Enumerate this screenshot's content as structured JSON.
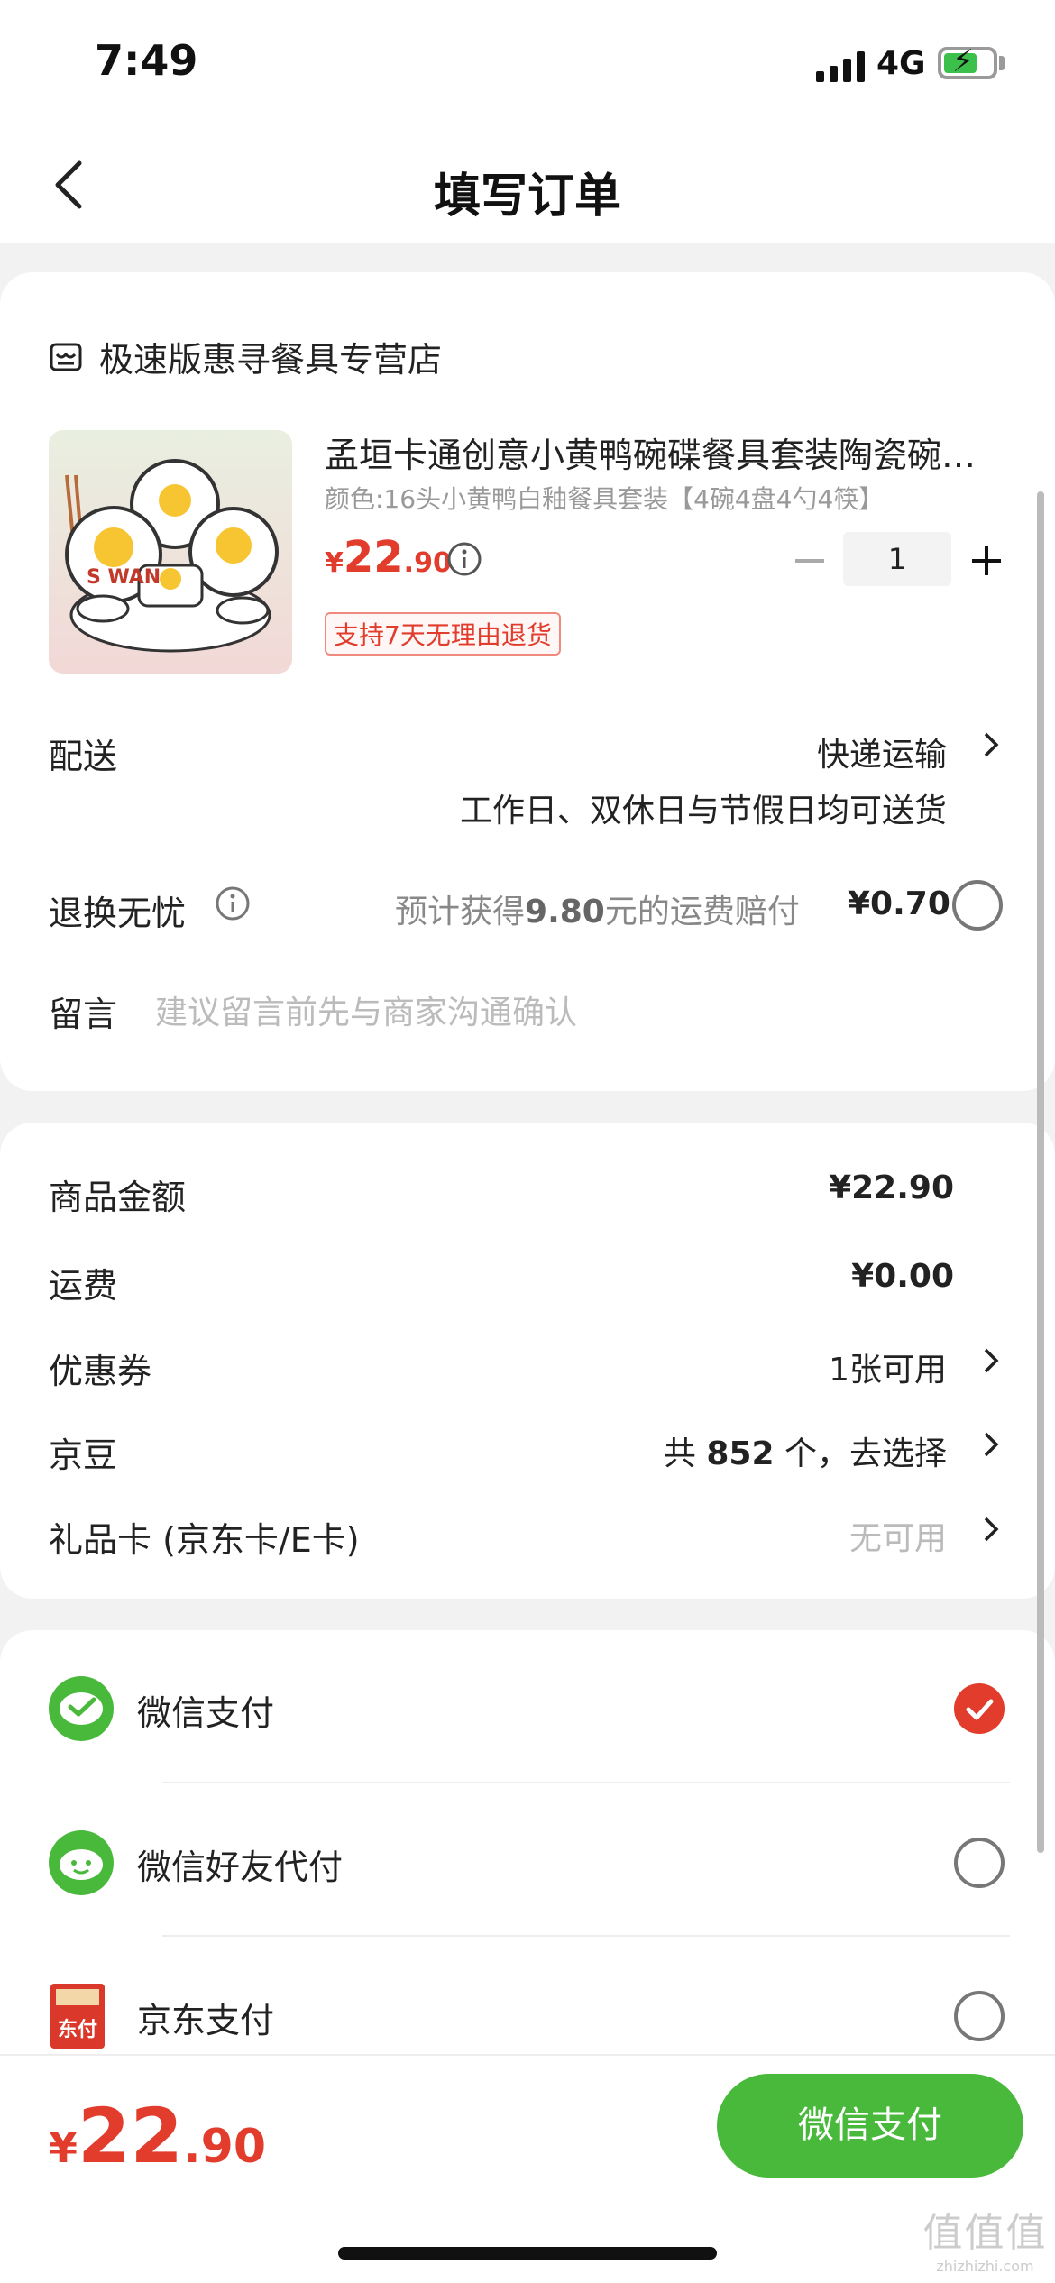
{
  "status_bar": {
    "time": "7:49",
    "network": "4G"
  },
  "nav": {
    "title": "填写订单"
  },
  "store": {
    "name": "极速版惠寻餐具专营店"
  },
  "product": {
    "title": "孟垣卡通创意小黄鸭碗碟餐具套装陶瓷碗…",
    "spec": "颜色:16头小黄鸭白釉餐具套装【4碗4盘4勺4筷】",
    "price_currency": "¥",
    "price_int": "22",
    "price_dec": ".90",
    "quantity": "1",
    "return_badge": "支持7天无理由退货",
    "image_text": "S WAN"
  },
  "delivery": {
    "label": "配送",
    "value": "快递运输",
    "sub": "工作日、双休日与节假日均可送货"
  },
  "worry_free": {
    "label": "退换无忧",
    "desc_prefix": "预计获得",
    "desc_amount": "9.80",
    "desc_suffix": "元的运费赔付",
    "price": "¥0.70"
  },
  "message": {
    "label": "留言",
    "placeholder": "建议留言前先与商家沟通确认"
  },
  "price_rows": [
    {
      "label": "商品金额",
      "value": "¥22.90"
    },
    {
      "label": "运费",
      "value": "¥0.00"
    },
    {
      "label": "优惠券",
      "value": "1张可用"
    },
    {
      "label": "京豆",
      "value_prefix": "共",
      "value_num": "852",
      "value_suffix": "个，去选择"
    },
    {
      "label": "礼品卡 (京东卡/E卡)",
      "value": "无可用"
    }
  ],
  "payment_methods": [
    {
      "label": "微信支付",
      "selected": true
    },
    {
      "label": "微信好友代付",
      "selected": false
    },
    {
      "label": "京东支付",
      "selected": false,
      "icon_text": "东付"
    }
  ],
  "footer": {
    "total_currency": "¥",
    "total_int": "22",
    "total_dec": ".90",
    "pay_button": "微信支付"
  },
  "watermark": {
    "mark": "值值值",
    "url": "zhizhizhi.com"
  },
  "colors": {
    "accent_red": "#e23c2c",
    "wechat_green": "#49b93b"
  }
}
